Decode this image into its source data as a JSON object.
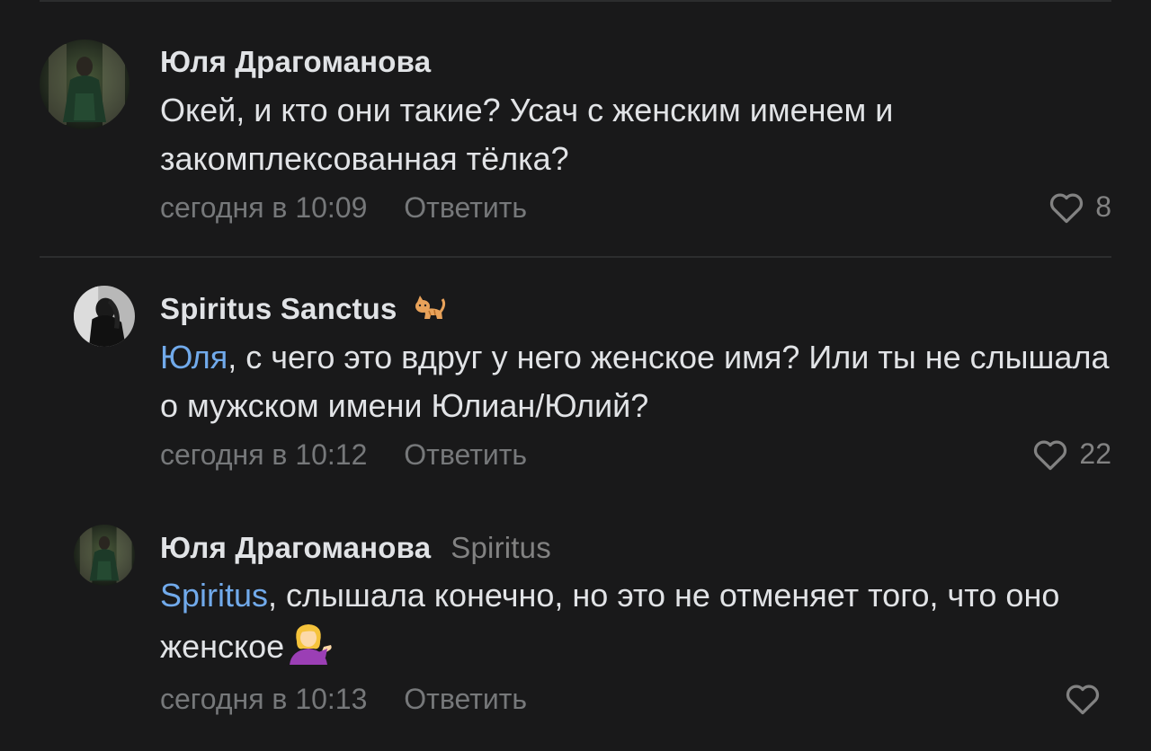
{
  "colors": {
    "background": "#19191a",
    "text_primary": "#e1e3e6",
    "text_secondary": "#76787a",
    "mention": "#71aaeb",
    "divider": "#2c2d2e"
  },
  "comments": [
    {
      "author": "Юля Драгоманова",
      "reply_to": "",
      "mention": "",
      "text": "Окей, и кто они такие? Усач с женским именем и закомплексованная тёлка?",
      "timestamp": "сегодня в 10:09",
      "reply_label": "Ответить",
      "likes": "8",
      "avatar_icon": "avatar-photo"
    },
    {
      "author": "Spiritus Sanctus",
      "reply_to": "",
      "mention": "Юля",
      "text": ", с чего это вдруг у него женское имя? Или ты не слышала о мужском имени Юлиан/Юлий?",
      "timestamp": "сегодня в 10:12",
      "reply_label": "Ответить",
      "likes": "22",
      "avatar_icon": "avatar-photo",
      "badge_icon": "cat-icon"
    },
    {
      "author": "Юля Драгоманова",
      "reply_to": "Spiritus",
      "mention": "Spiritus",
      "text": ", слышала конечно, но это не отменяет того, что оно женское",
      "timestamp": "сегодня в 10:13",
      "reply_label": "Ответить",
      "likes": "",
      "avatar_icon": "avatar-photo",
      "emoji_icon": "tipping-hand-woman-emoji"
    }
  ]
}
